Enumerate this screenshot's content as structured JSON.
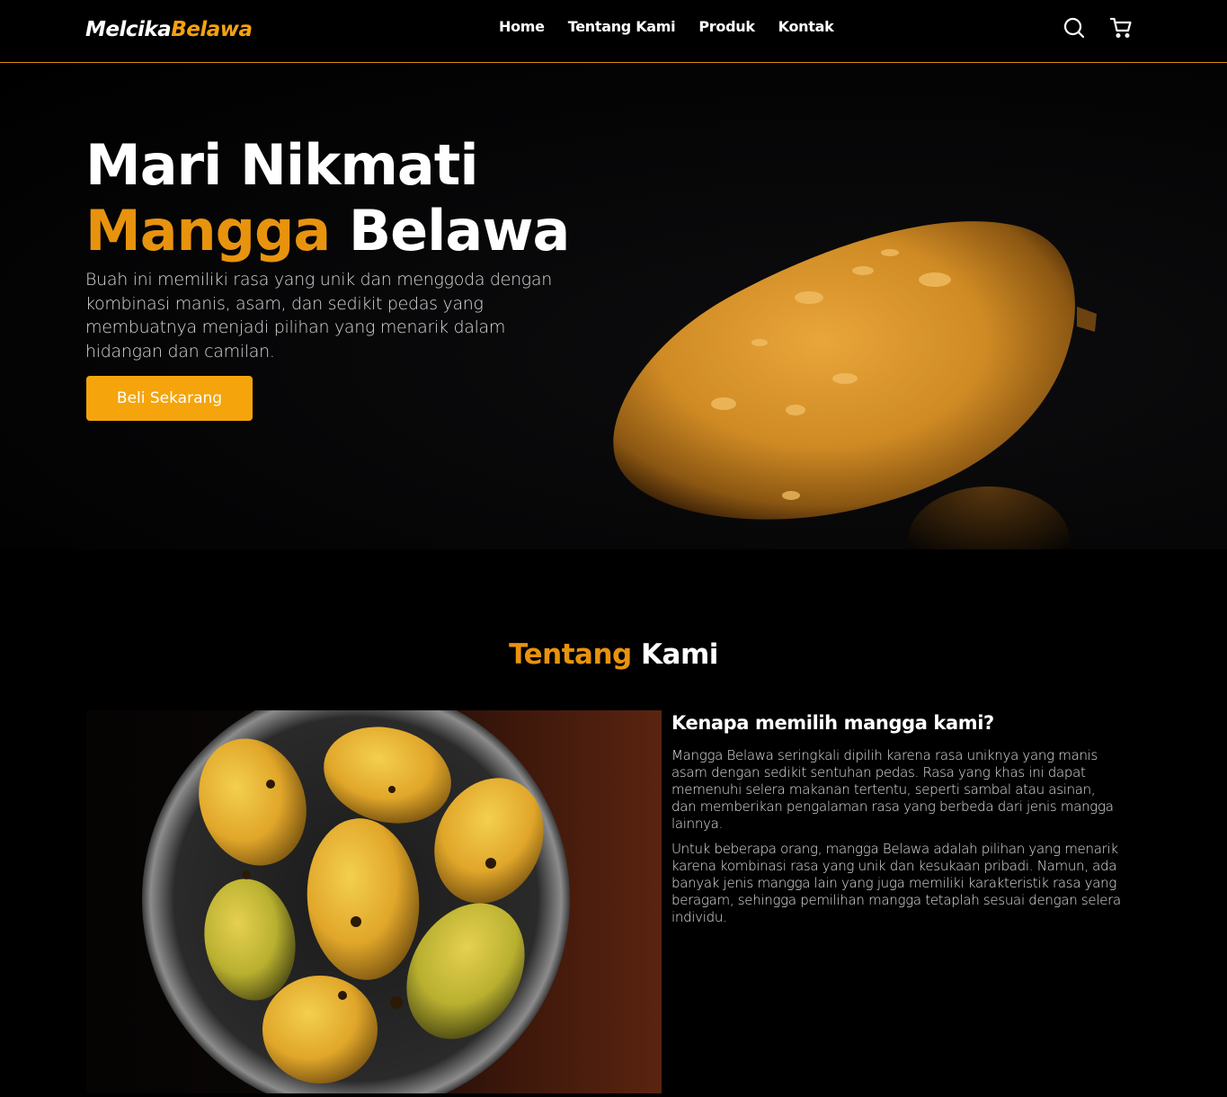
{
  "brand": {
    "part1": "Melcika",
    "part2": "Belawa",
    "accent_color": "#f5a10f"
  },
  "nav": {
    "links": [
      {
        "label": "Home"
      },
      {
        "label": "Tentang Kami"
      },
      {
        "label": "Produk"
      },
      {
        "label": "Kontak"
      }
    ],
    "icons": [
      "search-icon",
      "shopping-cart-icon"
    ]
  },
  "hero": {
    "title_line1": "Mari Nikmati",
    "title_accent": "Mangga",
    "title_rest": "Belawa",
    "description": "Buah ini memiliki rasa yang unik dan menggoda dengan kombinasi manis, asam, dan sedikit pedas yang membuatnya menjadi pilihan yang menarik dalam hidangan dan camilan.",
    "cta_label": "Beli Sekarang",
    "cta_color": "#f5a40c"
  },
  "about": {
    "title_accent": "Tentang",
    "title_rest": "Kami",
    "heading": "Kenapa memilih mangga kami?",
    "paragraphs": [
      "Mangga Belawa seringkali dipilih karena rasa uniknya yang manis asam dengan sedikit sentuhan pedas. Rasa yang khas ini dapat memenuhi selera makanan tertentu, seperti sambal atau asinan, dan memberikan pengalaman rasa yang berbeda dari jenis mangga lainnya.",
      "Untuk beberapa orang, mangga Belawa adalah pilihan yang menarik karena kombinasi rasa yang unik dan kesukaan pribadi. Namun, ada banyak jenis mangga lain yang juga memiliki karakteristik rasa yang beragam, sehingga pemilihan mangga tetaplah sesuai dengan selera individu."
    ]
  }
}
